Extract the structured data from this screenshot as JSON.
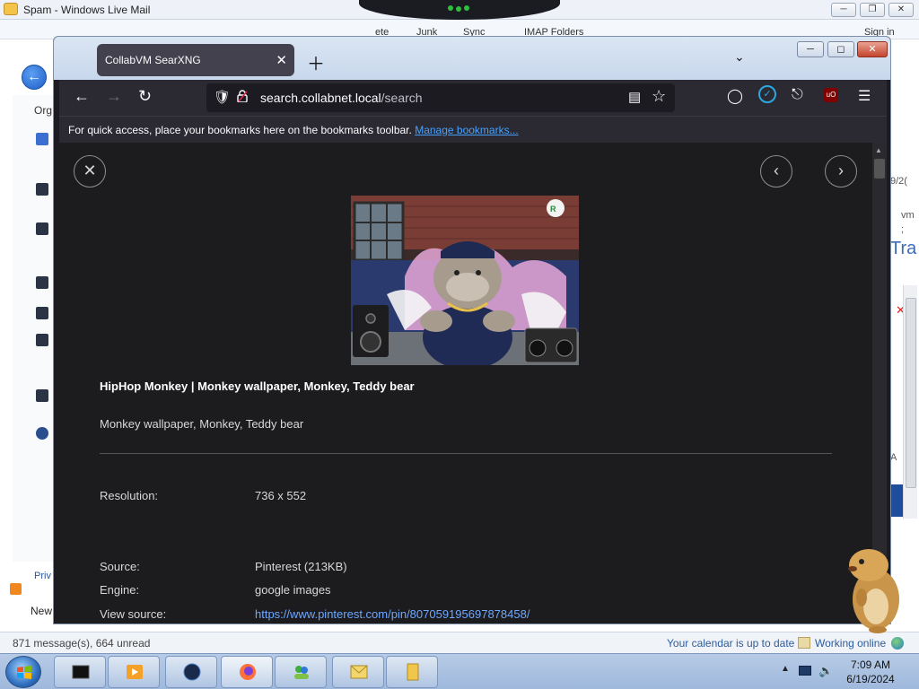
{
  "livemail": {
    "window_title": "Spam - Windows Live Mail",
    "menu_delete": "ete",
    "menu_junk": "Junk",
    "menu_sync": "Sync",
    "menu_imap": "IMAP Folders",
    "sign_in": "Sign in",
    "org_label": "Org",
    "right_frag_1": "9/2(",
    "right_frag_2": "vm",
    "right_frag_3": ";",
    "right_frag_4": "Tra",
    "right_frag_5": "A",
    "priv_label": "Priv",
    "new_label": "New",
    "status_left": "871 message(s), 664 unread",
    "status_calendar": "Your calendar is up to date",
    "status_online": "Working online"
  },
  "firefox": {
    "tab_title": "CollabVM SearXNG",
    "url_host": "search.collabnet.local",
    "url_path": "/search",
    "bookmarks_msg": "For quick access, place your bookmarks here on the bookmarks toolbar.",
    "bookmarks_link": "Manage bookmarks...",
    "ublock_label": "uO"
  },
  "result": {
    "title": "HipHop Monkey | Monkey wallpaper, Monkey, Teddy bear",
    "description": "Monkey wallpaper, Monkey, Teddy bear",
    "resolution_label": "Resolution:",
    "resolution_value": "736 x 552",
    "source_label": "Source:",
    "source_value": "Pinterest (213KB)",
    "engine_label": "Engine:",
    "engine_value": "google images",
    "view_source_label": "View source:",
    "view_source_value": "https://www.pinterest.com/pin/807059195697878458/"
  },
  "taskbar": {
    "time": "7:09 AM",
    "date": "6/19/2024"
  },
  "colors": {
    "ff_dark": "#1c1b22",
    "link_blue": "#6ea7ff",
    "taskbar": "#b7cbe6"
  }
}
